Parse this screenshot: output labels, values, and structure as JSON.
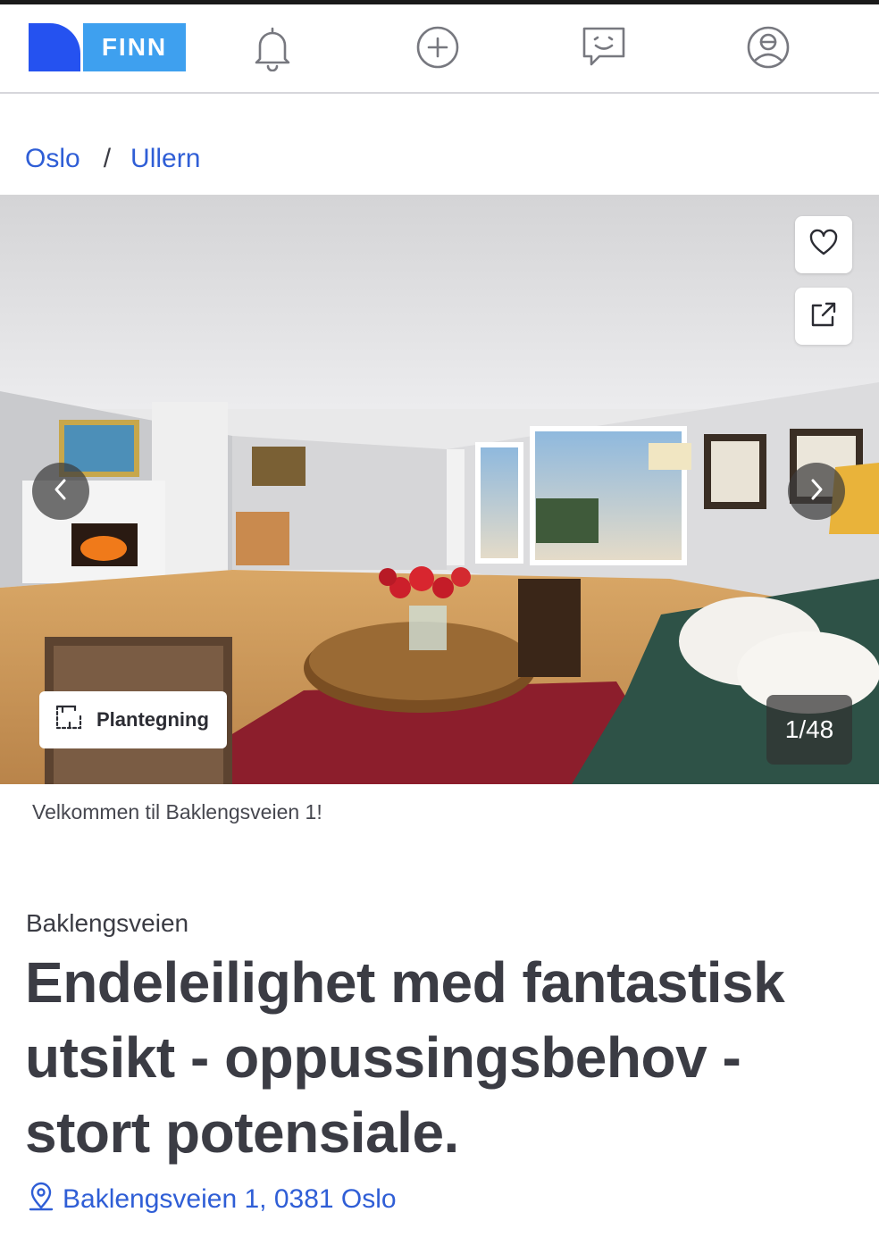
{
  "nav": {
    "logo_text": "FINN",
    "icons": [
      "bell-icon",
      "plus-circle-icon",
      "chat-icon",
      "profile-icon"
    ]
  },
  "breadcrumb": {
    "items": [
      "Oslo",
      "Ullern"
    ],
    "separator": "/"
  },
  "gallery": {
    "floorplan_label": "Plantegning",
    "counter": "1/48",
    "caption": "Velkommen til Baklengsveien 1!"
  },
  "listing": {
    "street": "Baklengsveien",
    "title": "Endeleilighet med fantastisk utsikt - oppussingsbehov - stort potensiale.",
    "address": "Baklengsveien 1, 0381 Oslo"
  },
  "colors": {
    "brand_blue": "#2552f0",
    "brand_light_blue": "#3ea0ef",
    "link": "#2f5ed6",
    "text": "#3b3c44"
  }
}
